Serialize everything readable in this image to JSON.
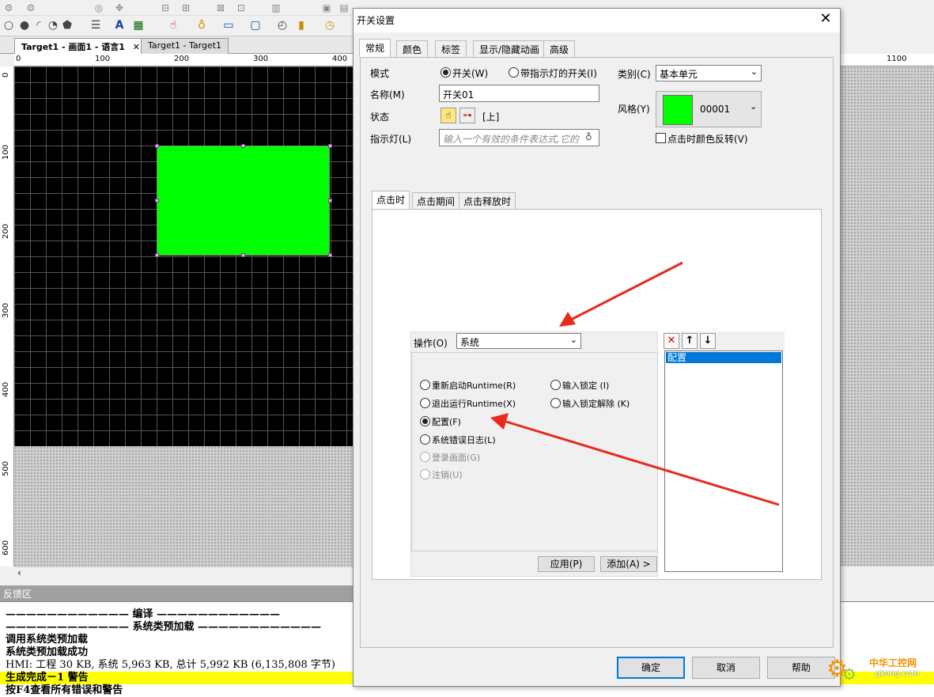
{
  "doc_tabs": [
    {
      "label": "Target1 - 画面1 - 语言1"
    },
    {
      "label": "Target1 - Target1"
    }
  ],
  "hruler_ticks": [
    "0",
    "100",
    "200",
    "300",
    "400"
  ],
  "hruler_right_tick": "1100",
  "vruler_ticks": [
    "0",
    "100",
    "200",
    "300",
    "400",
    "500",
    "600"
  ],
  "feedback": {
    "title": "反馈区",
    "lines": [
      "———————————— 编译 ————————————",
      "———————————— 系统类预加载 ————————————",
      "调用系统类预加载",
      "系统类预加载成功",
      "HMI: 工程 30 KB, 系统 5,963 KB, 总计 5,992 KB (6,135,808 字节)",
      "生成完成－1 警告",
      "按F4查看所有错误和警告"
    ]
  },
  "dialog": {
    "title": "开关设置",
    "close_glyph": "✕",
    "tabs": [
      "常规",
      "颜色",
      "标签",
      "显示/隐藏动画",
      "高级"
    ],
    "mode_label": "模式",
    "mode_switch": "开关(W)",
    "mode_indicator_switch": "带指示灯的开关(I)",
    "name_label": "名称(M)",
    "name_value": "开关01",
    "state_label": "状态",
    "state_value": "[上]",
    "indicator_label": "指示灯(L)",
    "indicator_placeholder": "输入一个有效的条件表达式,它的",
    "category_label": "类别(C)",
    "category_value": "基本单元",
    "style_label": "风格(Y)",
    "style_value": "00001",
    "invert_label": "点击时颜色反转(V)",
    "sub_tabs": [
      "点击时",
      "点击期间",
      "点击释放时"
    ],
    "operation_label": "操作(O)",
    "operation_value": "系统",
    "options": {
      "restart_runtime": "重新启动Runtime(R)",
      "exit_runtime": "退出运行Runtime(X)",
      "config": "配置(F)",
      "error_log": "系统错误日志(L)",
      "login_screen": "登录画面(G)",
      "logout": "注销(U)",
      "input_lock": "输入锁定 (I)",
      "input_unlock": "输入锁定解除 (K)"
    },
    "apply_button": "应用(P)",
    "add_button": "添加(A) >",
    "list_item": "配置",
    "ok_button": "确定",
    "cancel_button": "取消",
    "help_button": "帮助"
  },
  "watermark": {
    "name": "中华工控网",
    "url": "gkong.com"
  }
}
